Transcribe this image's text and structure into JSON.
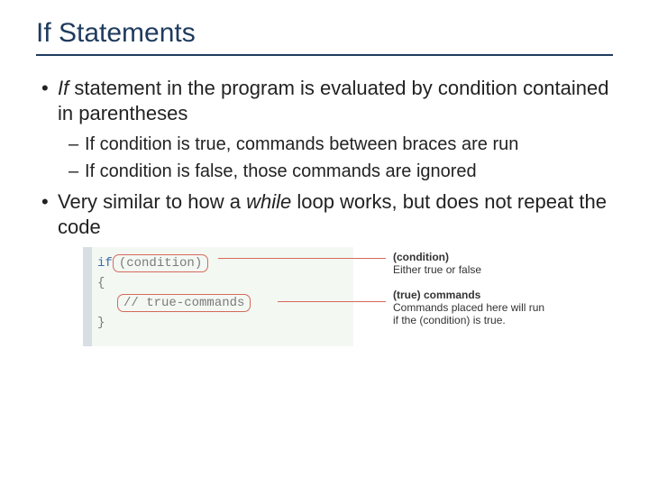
{
  "title": "If Statements",
  "bullets": {
    "p1_prefix_italic": "If",
    "p1_rest": " statement in the program is evaluated by condition contained in parentheses",
    "s1": "If condition is true, commands between braces are run",
    "s2": "If condition is false, those commands are ignored",
    "p2_pre": "Very similar to how a ",
    "p2_italic": "while",
    "p2_post": " loop works, but does not repeat the code"
  },
  "code": {
    "kw_if": "if",
    "cond": "condition",
    "brace_open": "{",
    "comment": "// true-commands",
    "brace_close": "}"
  },
  "callouts": {
    "c1_title": "(condition)",
    "c1_body": "Either true or false",
    "c2_title": "(true) commands",
    "c2_body1": "Commands placed here will run",
    "c2_body2": "if the (condition) is true."
  }
}
